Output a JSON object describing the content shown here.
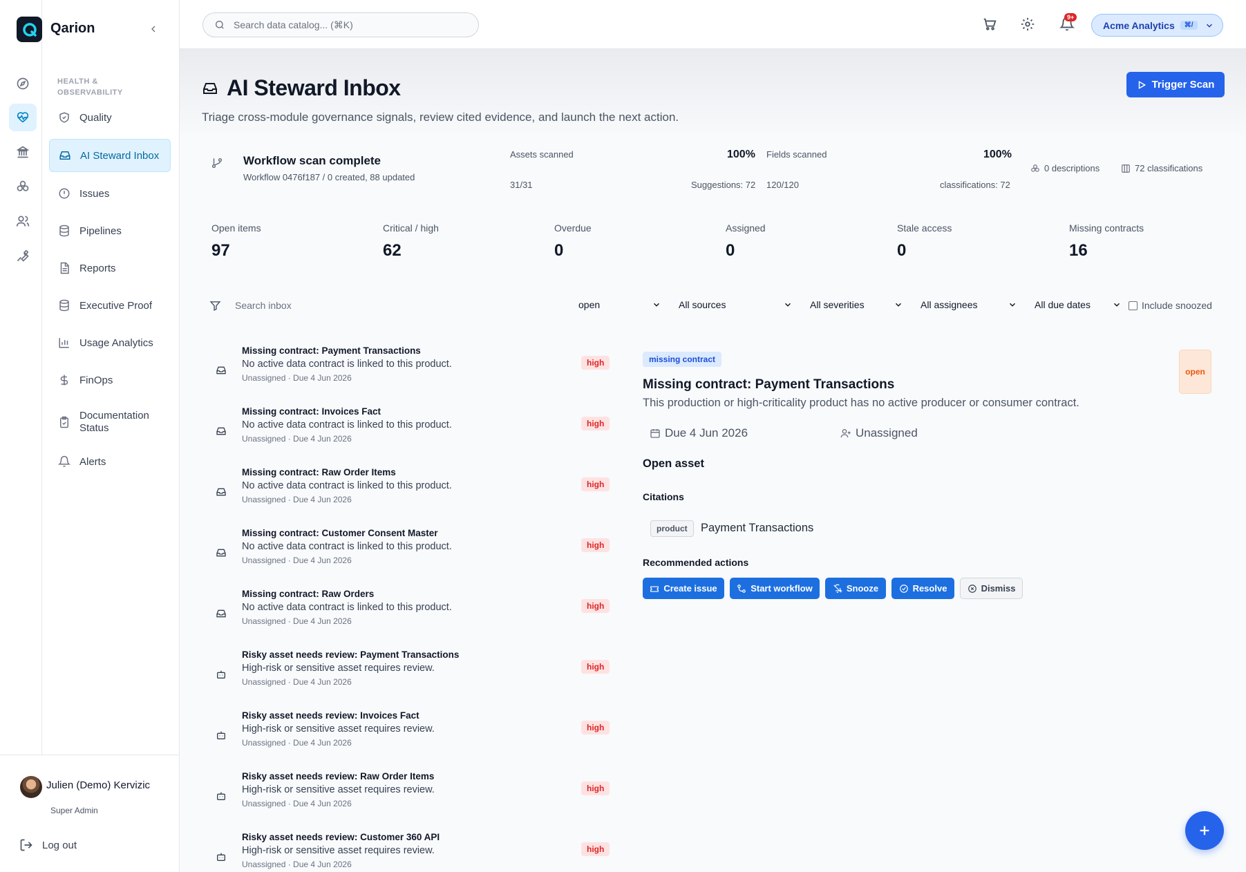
{
  "app": {
    "name": "Qarion"
  },
  "sidebar": {
    "section_title": "HEALTH & OBSERVABILITY",
    "items": [
      {
        "label": "Quality",
        "icon": "shield-check-icon"
      },
      {
        "label": "AI Steward Inbox",
        "icon": "inbox-icon",
        "active": true
      },
      {
        "label": "Issues",
        "icon": "alert-circle-icon"
      },
      {
        "label": "Pipelines",
        "icon": "database-icon"
      },
      {
        "label": "Reports",
        "icon": "file-text-icon"
      },
      {
        "label": "Executive Proof",
        "icon": "database-icon"
      },
      {
        "label": "Usage Analytics",
        "icon": "bar-chart-icon"
      },
      {
        "label": "FinOps",
        "icon": "dollar-icon"
      },
      {
        "label": "Documentation Status",
        "icon": "clipboard-check-icon"
      },
      {
        "label": "Alerts",
        "icon": "bell-icon"
      }
    ],
    "user": {
      "name": "Julien (Demo) Kervizic",
      "role": "Super Admin"
    },
    "logout_label": "Log out"
  },
  "topbar": {
    "search_placeholder": "Search data catalog... (⌘K)",
    "notification_badge": "9+",
    "org_name": "Acme Analytics",
    "org_shortcut": "⌘/"
  },
  "header": {
    "title": "AI Steward Inbox",
    "subtitle": "Triage cross-module governance signals, review cited evidence, and launch the next action.",
    "trigger_label": "Trigger Scan"
  },
  "scan": {
    "title": "Workflow scan complete",
    "subtitle": "Workflow 0476f187 / 0 created, 88 updated",
    "assets_label": "Assets scanned",
    "assets_pct": "100%",
    "assets_count": "31/31",
    "assets_suggestions": "Suggestions: 72",
    "fields_label": "Fields scanned",
    "fields_pct": "100%",
    "fields_count": "120/120",
    "fields_classifications": "classifications: 72",
    "descriptions": "0 descriptions",
    "classifications": "72 classifications"
  },
  "stats": [
    {
      "label": "Open items",
      "value": "97"
    },
    {
      "label": "Critical / high",
      "value": "62"
    },
    {
      "label": "Overdue",
      "value": "0"
    },
    {
      "label": "Assigned",
      "value": "0"
    },
    {
      "label": "Stale access",
      "value": "0"
    },
    {
      "label": "Missing contracts",
      "value": "16"
    }
  ],
  "filters": {
    "search_placeholder": "Search inbox",
    "status": "open",
    "sources": "All sources",
    "severities": "All severities",
    "assignees": "All assignees",
    "due_dates": "All due dates",
    "include_snoozed": "Include snoozed"
  },
  "items": [
    {
      "title": "Missing contract: Payment Transactions",
      "desc": "No active data contract is linked to this product.",
      "meta": "Unassigned · Due 4 Jun 2026",
      "severity": "high",
      "icon": "inbox-icon"
    },
    {
      "title": "Missing contract: Invoices Fact",
      "desc": "No active data contract is linked to this product.",
      "meta": "Unassigned · Due 4 Jun 2026",
      "severity": "high",
      "icon": "inbox-icon"
    },
    {
      "title": "Missing contract: Raw Order Items",
      "desc": "No active data contract is linked to this product.",
      "meta": "Unassigned · Due 4 Jun 2026",
      "severity": "high",
      "icon": "inbox-icon"
    },
    {
      "title": "Missing contract: Customer Consent Master",
      "desc": "No active data contract is linked to this product.",
      "meta": "Unassigned · Due 4 Jun 2026",
      "severity": "high",
      "icon": "inbox-icon"
    },
    {
      "title": "Missing contract: Raw Orders",
      "desc": "No active data contract is linked to this product.",
      "meta": "Unassigned · Due 4 Jun 2026",
      "severity": "high",
      "icon": "inbox-icon"
    },
    {
      "title": "Risky asset needs review: Payment Transactions",
      "desc": "High-risk or sensitive asset requires review.",
      "meta": "Unassigned · Due 4 Jun 2026",
      "severity": "high",
      "icon": "bot-icon"
    },
    {
      "title": "Risky asset needs review: Invoices Fact",
      "desc": "High-risk or sensitive asset requires review.",
      "meta": "Unassigned · Due 4 Jun 2026",
      "severity": "high",
      "icon": "bot-icon"
    },
    {
      "title": "Risky asset needs review: Raw Order Items",
      "desc": "High-risk or sensitive asset requires review.",
      "meta": "Unassigned · Due 4 Jun 2026",
      "severity": "high",
      "icon": "bot-icon"
    },
    {
      "title": "Risky asset needs review: Customer 360 API",
      "desc": "High-risk or sensitive asset requires review.",
      "meta": "Unassigned · Due 4 Jun 2026",
      "severity": "high",
      "icon": "bot-icon"
    }
  ],
  "detail": {
    "tag": "missing contract",
    "status": "open",
    "title": "Missing contract: Payment Transactions",
    "description": "This production or high-criticality product has no active producer or consumer contract.",
    "due": "Due 4 Jun 2026",
    "assignee": "Unassigned",
    "open_asset": "Open asset",
    "citations_title": "Citations",
    "citation_kind": "product",
    "citation_name": "Payment Transactions",
    "actions_title": "Recommended actions",
    "actions": {
      "create_issue": "Create issue",
      "start_workflow": "Start workflow",
      "snooze": "Snooze",
      "resolve": "Resolve",
      "dismiss": "Dismiss"
    }
  },
  "colors": {
    "accent": "#2563eb",
    "severity_high": "#dc2626",
    "active_nav": "#e0f2fe"
  }
}
